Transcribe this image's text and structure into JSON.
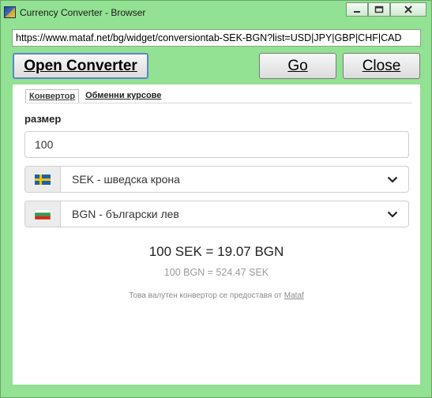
{
  "window": {
    "title": "Currency Converter - Browser",
    "controls": {
      "minimize": "▭",
      "maximize": "□",
      "close": "✕"
    }
  },
  "address_bar": {
    "url": "https://www.mataf.net/bg/widget/conversiontab-SEK-BGN?list=USD|JPY|GBP|CHF|CAD"
  },
  "toolbar": {
    "open_label": "Open Converter",
    "go_label": "Go",
    "close_label": "Close"
  },
  "tabs": [
    {
      "label": "Конвертор",
      "active": true
    },
    {
      "label": "Обменни курсове",
      "active": false
    }
  ],
  "form": {
    "amount_label": "размер",
    "amount_value": "100",
    "from_currency": "SEK - шведска крона",
    "to_currency": "BGN - български лев"
  },
  "result": {
    "main": "100 SEK = 19.07 BGN",
    "reverse": "100 BGN = 524.47 SEK",
    "credit_prefix": "Това валутен конвертор се предоставя от",
    "credit_link": "Mataf"
  },
  "colors": {
    "window_bg": "#93e193",
    "accent_border": "#5a86c8"
  },
  "icons": {
    "from_flag": "sweden-flag-icon",
    "to_flag": "bulgaria-flag-icon",
    "dropdown": "chevron-down-icon"
  }
}
